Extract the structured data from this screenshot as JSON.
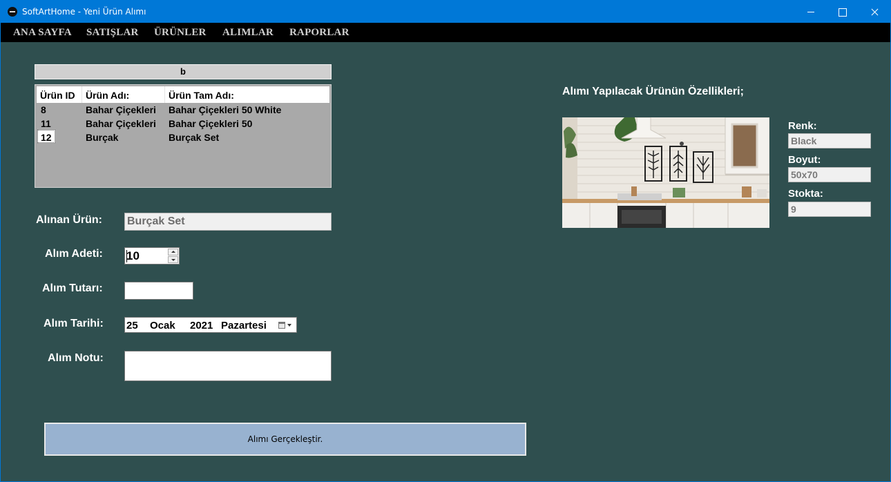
{
  "window": {
    "title": "SoftArtHome - Yeni Ürün Alımı"
  },
  "menu": [
    {
      "label": "ANA SAYFA"
    },
    {
      "label": "SATIŞLAR"
    },
    {
      "label": "ÜRÜNLER"
    },
    {
      "label": "ALIMLAR"
    },
    {
      "label": "RAPORLAR"
    }
  ],
  "grid": {
    "header": "b",
    "columns": [
      "Ürün ID",
      "Ürün Adı:",
      "Ürün Tam Adı:"
    ],
    "rows": [
      {
        "id": "8",
        "name": "Bahar Çiçekleri",
        "full": "Bahar Çiçekleri 50 White"
      },
      {
        "id": "11",
        "name": "Bahar Çiçekleri",
        "full": "Bahar Çiçekleri 50"
      },
      {
        "id": "12",
        "name": "Burçak",
        "full": "Burçak Set"
      }
    ],
    "selected_row": 2
  },
  "form": {
    "product_label": "Alınan Ürün:",
    "product_value": "Burçak Set",
    "quantity_label": "Alım Adeti:",
    "quantity_value": "10",
    "amount_label": "Alım Tutarı:",
    "amount_value": "",
    "date_label": "Alım Tarihi:",
    "date": {
      "day": "25",
      "month": "Ocak",
      "year": "2021",
      "weekday": "Pazartesi"
    },
    "note_label": "Alım Notu:",
    "note_value": "",
    "submit_label": "Alımı Gerçekleştir."
  },
  "details": {
    "title": "Alımı Yapılacak Ürünün Özellikleri;",
    "color_label": "Renk:",
    "color_value": "Black",
    "size_label": "Boyut:",
    "size_value": "50x70",
    "stock_label": "Stokta:",
    "stock_value": "9"
  },
  "colors": {
    "titlebar": "#0078d7",
    "background": "#2f4f4f",
    "menubar": "#000000",
    "grid_body": "#a9a9a9",
    "button": "#98b2d0"
  }
}
